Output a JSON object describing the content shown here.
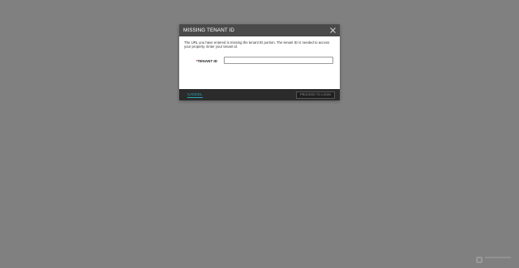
{
  "dialog": {
    "title": "MISSING TENANT ID",
    "close_icon": "close-icon",
    "message": "The URL you have entered is missing the tenant ID portion. The tenant ID is needed to access your property. Enter your tenant id.",
    "field": {
      "required_marker": "*",
      "label": "TENANT ID",
      "value": "",
      "placeholder": ""
    },
    "footer": {
      "cancel_label": "CANCEL",
      "proceed_label": "PROCEED TO LOGIN"
    }
  },
  "colors": {
    "backdrop": "#808080",
    "header": "#4a4a4a",
    "footer": "#2b2b2b",
    "accent": "#2aa7b8"
  },
  "watermark": {
    "icon": "logo-watermark-icon"
  }
}
